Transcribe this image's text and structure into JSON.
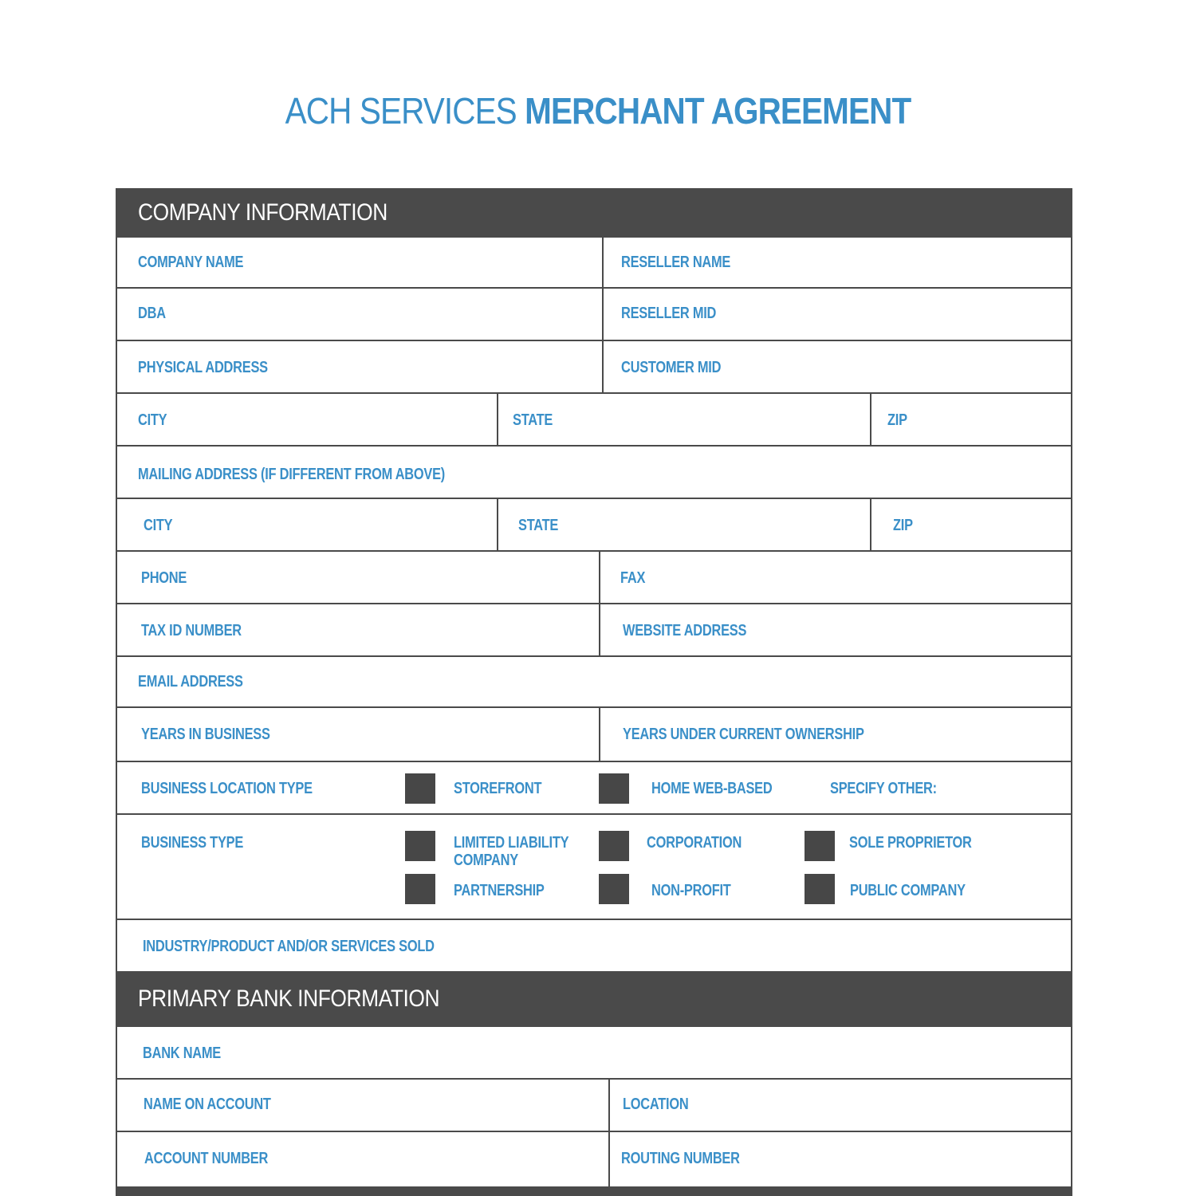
{
  "document": {
    "title_light": "ACH SERVICES",
    "title_bold": "MERCHANT AGREEMENT",
    "accent_color": "#3a8fc8",
    "header_color": "#4a4a4a"
  },
  "company_information": {
    "header": "COMPANY INFORMATION",
    "fields": {
      "company_name": "COMPANY NAME",
      "reseller_name": "RESELLER NAME",
      "dba": "DBA",
      "reseller_mid": "RESELLER MID",
      "physical_address": "PHYSICAL ADDRESS",
      "customer_mid": "CUSTOMER MID",
      "city": "CITY",
      "state": "STATE",
      "zip": "ZIP",
      "mailing_address": "MAILING ADDRESS (IF DIFFERENT FROM ABOVE)",
      "mailing_city": "CITY",
      "mailing_state": "STATE",
      "mailing_zip": "ZIP",
      "phone": "PHONE",
      "fax": "FAX",
      "tax_id": "TAX ID NUMBER",
      "website": "WEBSITE ADDRESS",
      "email": "EMAIL ADDRESS",
      "years_in_business": "YEARS IN BUSINESS",
      "years_ownership": "YEARS UNDER CURRENT OWNERSHIP",
      "industry": "INDUSTRY/PRODUCT AND/OR SERVICES SOLD"
    },
    "business_location_type": {
      "label": "BUSINESS LOCATION TYPE",
      "options": [
        "STOREFRONT",
        "HOME WEB-BASED"
      ],
      "other_label": "SPECIFY OTHER:"
    },
    "business_type": {
      "label": "BUSINESS  TYPE",
      "options": [
        "LIMITED LIABILITY",
        "COMPANY",
        "CORPORATION",
        "SOLE PROPRIETOR",
        "PARTNERSHIP",
        "NON-PROFIT",
        "PUBLIC COMPANY"
      ]
    }
  },
  "primary_bank_information": {
    "header": "PRIMARY BANK INFORMATION",
    "fields": {
      "bank_name": "BANK NAME",
      "name_on_account": "NAME ON ACCOUNT",
      "location": "LOCATION",
      "account_number": "ACCOUNT NUMBER",
      "routing_number": "ROUTING NUMBER"
    }
  }
}
